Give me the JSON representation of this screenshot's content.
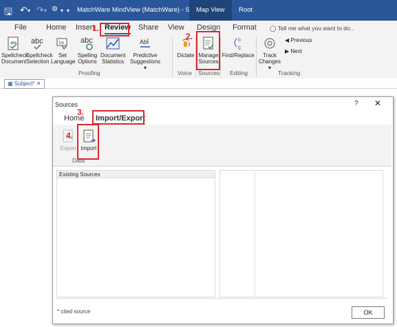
{
  "titlebar": {
    "title": "MatchWare MindView (MatchWare) - Subject",
    "context_tabs": [
      "Map View",
      "Root"
    ],
    "save_icon": "save-icon",
    "undo_icon": "undo-icon",
    "redo_icon": "redo-icon",
    "customize_icon": "customize-icon"
  },
  "tabs": [
    "File",
    "Home",
    "Insert",
    "Review",
    "Share",
    "View",
    "Design",
    "Format"
  ],
  "active_tab": "Review",
  "tellme": "Tell me what you want to do...",
  "ribbon": {
    "proofing": {
      "label": "Proofing",
      "buttons": [
        {
          "line1": "Spellcheck",
          "line2": "Document"
        },
        {
          "line1": "Spellcheck",
          "line2": "Selection"
        },
        {
          "line1": "Set",
          "line2": "Language"
        },
        {
          "line1": "Spelling",
          "line2": "Options"
        },
        {
          "line1": "Document",
          "line2": "Statistics"
        },
        {
          "line1": "Predictive",
          "line2": "Suggestions ▾"
        }
      ]
    },
    "voice": {
      "label": "Voice",
      "button": "Dictate"
    },
    "sources": {
      "label": "Sources",
      "line1": "Manage",
      "line2": "Sources"
    },
    "editing": {
      "label": "Editing",
      "button": "Find/Replace"
    },
    "tracking": {
      "label": "Tracking",
      "track_line1": "Track",
      "track_line2": "Changes ▾",
      "previous": "Previous",
      "next": "Next"
    }
  },
  "annotations": [
    "1.",
    "2.",
    "3.",
    "4."
  ],
  "doc_tab": {
    "label": "Subject*",
    "close": "✕"
  },
  "dialog": {
    "title": "Sources",
    "help": "?",
    "close": "✕",
    "tabs": [
      "Home",
      "Import/Export"
    ],
    "active_tab": "Import/Export",
    "export_label": "Export",
    "import_label": "Import",
    "group_label": "Data",
    "existing_sources_header": "Existing Sources",
    "cited_note": "* cited source",
    "ok_label": "OK"
  },
  "colors": {
    "titlebar": "#2b579a",
    "annotation": "#d9262e",
    "accent": "#2b579a"
  }
}
